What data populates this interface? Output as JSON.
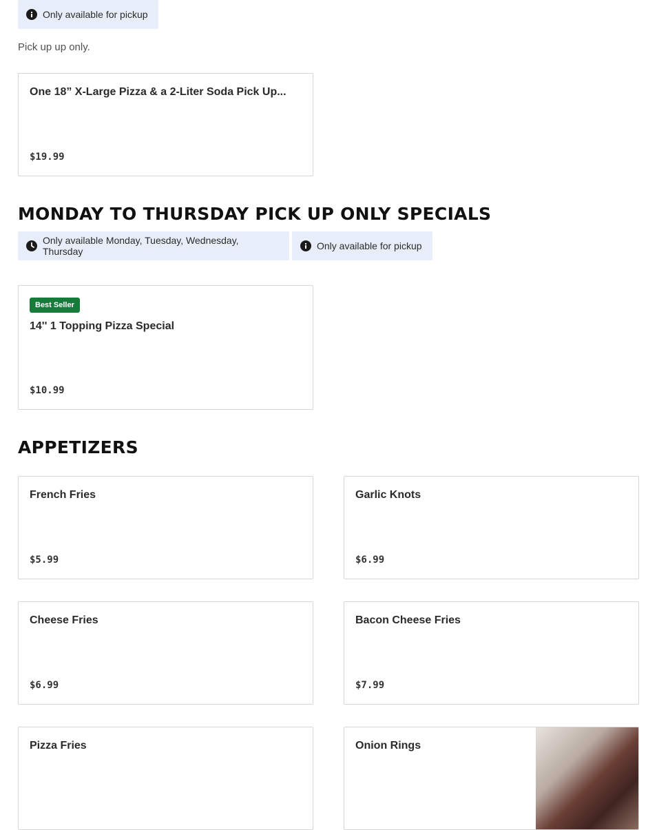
{
  "pickup_section": {
    "tag_label": "Only available for pickup",
    "note": "Pick up up only.",
    "items": [
      {
        "name": "One 18” X-Large Pizza & a 2-Liter Soda Pick Up...",
        "price": "$19.99"
      }
    ]
  },
  "specials_section": {
    "title": "MONDAY TO THURSDAY PICK UP ONLY SPECIALS",
    "days_tag": "Only available Monday, Tuesday, Wednesday, Thursday",
    "pickup_tag": "Only available for pickup",
    "items": [
      {
        "badge": "Best Seller",
        "name": "14'' 1 Topping Pizza Special",
        "price": "$10.99"
      }
    ]
  },
  "appetizers_section": {
    "title": "APPETIZERS",
    "items": [
      {
        "name": "French Fries",
        "price": "$5.99"
      },
      {
        "name": "Garlic Knots",
        "price": "$6.99"
      },
      {
        "name": "Cheese Fries",
        "price": "$6.99"
      },
      {
        "name": "Bacon Cheese Fries",
        "price": "$7.99"
      },
      {
        "name": "Pizza Fries",
        "price": ""
      },
      {
        "name": "Onion Rings",
        "price": ""
      }
    ]
  },
  "colors": {
    "tag_bg": "#e8eef9",
    "badge_green": "#167a3a",
    "card_border": "#d6d6d6"
  },
  "icons": {
    "info": "info-icon",
    "clock": "clock-icon"
  }
}
